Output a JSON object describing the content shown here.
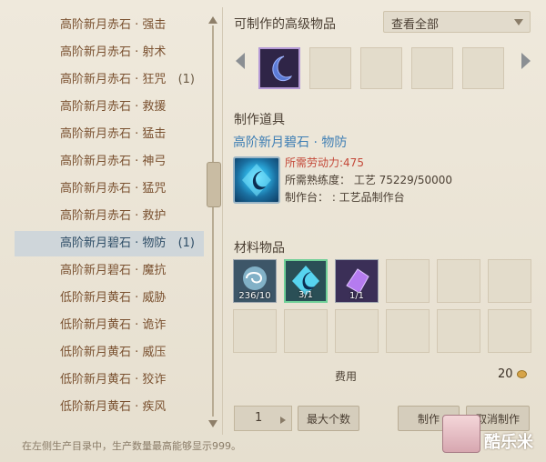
{
  "left_list": {
    "items": [
      {
        "label": "高阶新月赤石 · 强击",
        "count": ""
      },
      {
        "label": "高阶新月赤石 · 射术",
        "count": ""
      },
      {
        "label": "高阶新月赤石 · 狂咒",
        "count": "(1)"
      },
      {
        "label": "高阶新月赤石 · 救援",
        "count": ""
      },
      {
        "label": "高阶新月赤石 · 猛击",
        "count": ""
      },
      {
        "label": "高阶新月赤石 · 神弓",
        "count": ""
      },
      {
        "label": "高阶新月赤石 · 猛咒",
        "count": ""
      },
      {
        "label": "高阶新月赤石 · 救护",
        "count": ""
      },
      {
        "label": "高阶新月碧石 · 物防",
        "count": "(1)"
      },
      {
        "label": "高阶新月碧石 · 魔抗",
        "count": ""
      },
      {
        "label": "低阶新月黄石 · 威胁",
        "count": ""
      },
      {
        "label": "低阶新月黄石 · 诡诈",
        "count": ""
      },
      {
        "label": "低阶新月黄石 · 威压",
        "count": ""
      },
      {
        "label": "低阶新月黄石 · 狡诈",
        "count": ""
      },
      {
        "label": "低阶新月黄石 · 疾风",
        "count": ""
      }
    ],
    "selected_index": 8
  },
  "footer_note": "在左侧生产目录中，生产数量最高能够显示999。",
  "craftable": {
    "title": "可制作的高级物品",
    "filter": "查看全部"
  },
  "tool": {
    "section_title": "制作道具",
    "name": "高阶新月碧石 · 物防",
    "labor_cost": "所需劳动力:475",
    "proficiency": "所需熟练度： 工艺 75229/50000",
    "workbench": "制作台： : 工艺品制作台"
  },
  "materials": {
    "section_title": "材料物品",
    "slots": [
      {
        "qty": "236/10",
        "icon": "swirl-orb-icon"
      },
      {
        "qty": "3/1",
        "icon": "crescent-gem-icon"
      },
      {
        "qty": "1/1",
        "icon": "purple-crystal-icon"
      }
    ]
  },
  "fee": {
    "label": "费用",
    "value": "20"
  },
  "actions": {
    "quantity": "1",
    "max_button": "最大个数",
    "craft_button": "制作",
    "cancel_button": "取消制作"
  },
  "watermark": "酷乐米"
}
